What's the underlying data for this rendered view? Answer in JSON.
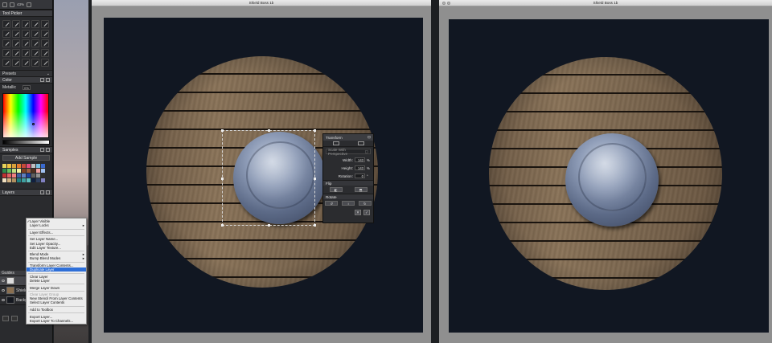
{
  "toolbar": {
    "zoom": "43%"
  },
  "panels": {
    "tool_picker": "Tool Picker",
    "presets": "Presets",
    "color": "Color",
    "metallic_label": "Metallic",
    "metallic_value": "0%",
    "samples": "Samples",
    "add_sample": "Add Sample",
    "layers": "Layers"
  },
  "sample_colors": [
    "#e6d25a",
    "#f0c040",
    "#d9a13b",
    "#e47a2e",
    "#c74a3a",
    "#e04b7a",
    "#c0c0c0",
    "#7ac0e0",
    "#3a6ad0",
    "#2c8a4a",
    "#6ac060",
    "#c0e080",
    "#f0f0a0",
    "#804020",
    "#a06040",
    "#503020",
    "#f0a0a0",
    "#a0c0f0",
    "#c03030",
    "#e06060",
    "#f08080",
    "#4060a0",
    "#6080c0",
    "#2040a0",
    "#606060",
    "#909090",
    "#303030",
    "#f0e0c0",
    "#d0b080",
    "#b09060",
    "#208080",
    "#40a0a0",
    "#60c0c0",
    "#102040",
    "#304060",
    "#8080c0"
  ],
  "context_menu": {
    "items": [
      {
        "label": "Layer Visible",
        "kind": "check"
      },
      {
        "label": "Layer Locks",
        "kind": "sub"
      },
      {
        "kind": "sep"
      },
      {
        "label": "Layer Effects..."
      },
      {
        "kind": "sep"
      },
      {
        "label": "Set Layer Name..."
      },
      {
        "label": "Set Layer Opacity..."
      },
      {
        "label": "Edit Layer Texture..."
      },
      {
        "kind": "sep"
      },
      {
        "label": "Blend Mode",
        "kind": "sub"
      },
      {
        "label": "Bump Blend Modes",
        "kind": "sub"
      },
      {
        "kind": "sep"
      },
      {
        "label": "Transform Layer Contents..."
      },
      {
        "label": "Duplicate Layer",
        "kind": "active"
      },
      {
        "kind": "sep"
      },
      {
        "label": "Clear Layer"
      },
      {
        "label": "Delete Layer"
      },
      {
        "kind": "sep"
      },
      {
        "label": "Merge Layer Down"
      },
      {
        "kind": "sep"
      },
      {
        "label": "Clear Layer Group",
        "kind": "disabled"
      },
      {
        "label": "New Stencil From Layer Contents"
      },
      {
        "label": "Select Layer Contents"
      },
      {
        "kind": "sep"
      },
      {
        "label": "Add to Toolbox"
      },
      {
        "kind": "sep"
      },
      {
        "label": "Export Layer..."
      },
      {
        "label": "Export Layer To Channels..."
      }
    ]
  },
  "layers": {
    "guides": "Guides",
    "rows": [
      {
        "name": "Shield Boss"
      },
      {
        "name": "Background"
      }
    ]
  },
  "windows": {
    "left_title": "Shield Boss 1b",
    "right_title": "Shield Boss 1b"
  },
  "transform": {
    "title": "Transform",
    "perspective_label": "Scale With Perspective",
    "width_label": "Width:",
    "width_value": "143",
    "width_unit": "%",
    "height_label": "Height:",
    "height_value": "143",
    "height_unit": "%",
    "rotation_label": "Rotation:",
    "rotation_value": "0",
    "rotation_unit": "°",
    "flip_label": "Flip",
    "rotate_label": "Rotate"
  }
}
